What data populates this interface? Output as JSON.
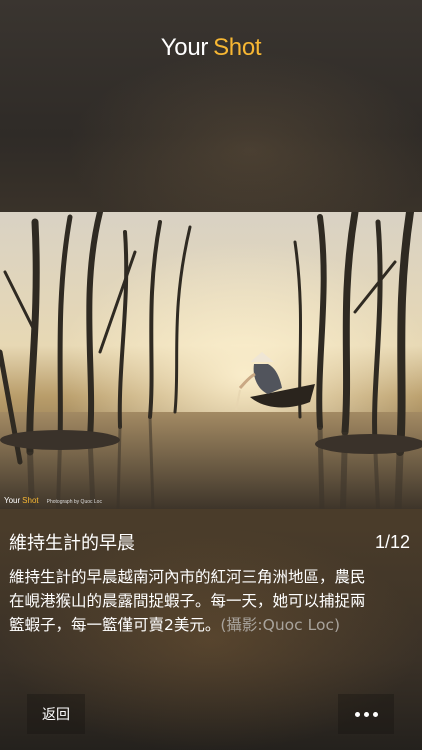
{
  "header": {
    "logo_your": "Your",
    "logo_shot": "Shot"
  },
  "photo": {
    "watermark_your": "Your",
    "watermark_shot": "Shot",
    "credit_line": "Photograph by Quoc Loc"
  },
  "caption": {
    "title": "維持生計的早晨",
    "counter": "1/12",
    "description_line1": "維持生計的早晨越南河內市的紅河三角洲地區，農民",
    "description_line2": "在峴港猴山的晨露間捉蝦子。每一天，她可以捕捉兩",
    "description_line3_main": "籃蝦子，每一籃僅可賣2美元。",
    "description_credit": "(攝影:Quoc Loc)"
  },
  "footer": {
    "back_label": "返回",
    "more_icon": "more-dots-icon"
  },
  "colors": {
    "accent": "#f7b733",
    "credit_gray": "#a8a39c"
  }
}
